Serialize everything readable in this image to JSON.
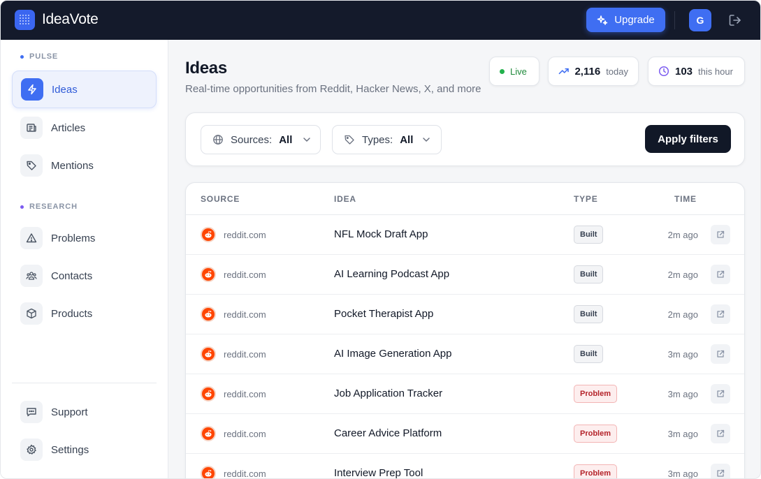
{
  "app": {
    "name": "IdeaVote",
    "accent": "#3f6ef2"
  },
  "topbar": {
    "upgrade_label": "Upgrade",
    "avatar_initial": "G"
  },
  "sidebar": {
    "sections": [
      {
        "label": "PULSE",
        "dot_color": "#3f6ef2"
      },
      {
        "label": "RESEARCH",
        "dot_color": "#7c5cf0"
      }
    ],
    "items": [
      {
        "label": "Ideas",
        "icon": "lightning-icon",
        "active": true
      },
      {
        "label": "Articles",
        "icon": "newspaper-icon"
      },
      {
        "label": "Mentions",
        "icon": "tag-icon"
      },
      {
        "label": "Problems",
        "icon": "warning-icon"
      },
      {
        "label": "Contacts",
        "icon": "users-icon"
      },
      {
        "label": "Products",
        "icon": "box-icon"
      },
      {
        "label": "Support",
        "icon": "chat-icon"
      },
      {
        "label": "Settings",
        "icon": "gear-icon"
      }
    ]
  },
  "header": {
    "title": "Ideas",
    "subtitle": "Real-time opportunities from Reddit, Hacker News, X, and more"
  },
  "stats": {
    "live_label": "Live",
    "today_value": "2,116",
    "today_label": "today",
    "hour_value": "103",
    "hour_label": "this hour"
  },
  "filters": {
    "sources_label": "Sources:",
    "sources_value": "All",
    "types_label": "Types:",
    "types_value": "All",
    "apply_label": "Apply filters"
  },
  "table": {
    "columns": [
      "SOURCE",
      "IDEA",
      "TYPE",
      "TIME"
    ],
    "rows": [
      {
        "source": "reddit.com",
        "idea": "NFL Mock Draft App",
        "type": "Built",
        "time": "2m ago"
      },
      {
        "source": "reddit.com",
        "idea": "AI Learning Podcast App",
        "type": "Built",
        "time": "2m ago"
      },
      {
        "source": "reddit.com",
        "idea": "Pocket Therapist App",
        "type": "Built",
        "time": "2m ago"
      },
      {
        "source": "reddit.com",
        "idea": "AI Image Generation App",
        "type": "Built",
        "time": "3m ago"
      },
      {
        "source": "reddit.com",
        "idea": "Job Application Tracker",
        "type": "Problem",
        "time": "3m ago"
      },
      {
        "source": "reddit.com",
        "idea": "Career Advice Platform",
        "type": "Problem",
        "time": "3m ago"
      },
      {
        "source": "reddit.com",
        "idea": "Interview Prep Tool",
        "type": "Problem",
        "time": "3m ago"
      }
    ]
  }
}
